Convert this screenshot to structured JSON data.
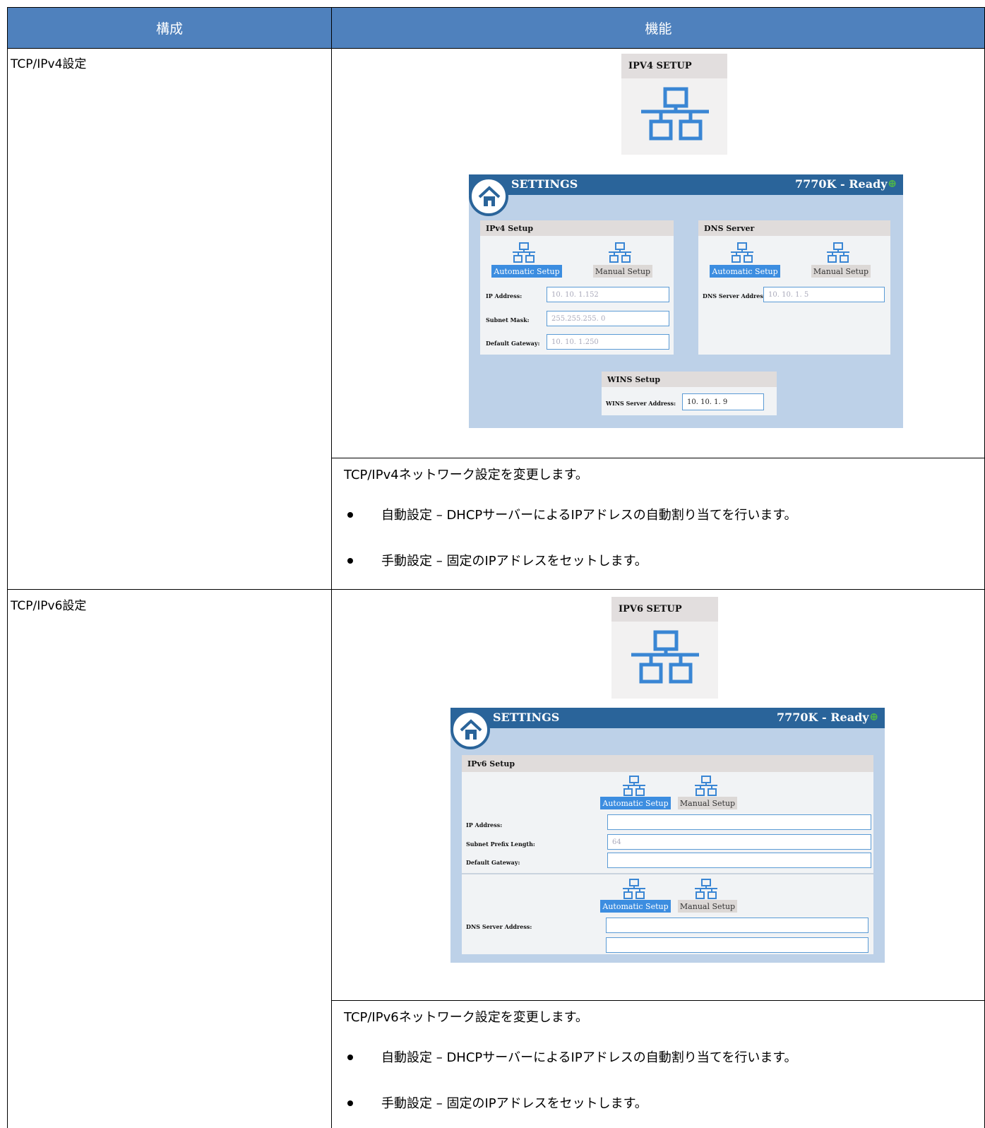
{
  "table": {
    "headers": [
      "構成",
      "機能"
    ]
  },
  "rows": [
    {
      "label": "TCP/IPv4設定",
      "tile": {
        "title": "IPV4 SETUP",
        "icon": "network-icon"
      },
      "screen": {
        "title": "SETTINGS",
        "status": "7770K - Ready",
        "ipv4_panel": {
          "title": "IPv4 Setup",
          "auto_label": "Automatic Setup",
          "manual_label": "Manual Setup",
          "fields": [
            {
              "label": "IP Address:",
              "value": "10. 10.  1.152"
            },
            {
              "label": "Subnet Mask:",
              "value": "255.255.255.  0"
            },
            {
              "label": "Default Gateway:",
              "value": "10. 10.  1.250"
            }
          ]
        },
        "dns_panel": {
          "title": "DNS Server",
          "auto_label": "Automatic Setup",
          "manual_label": "Manual Setup",
          "field_label": "DNS Server Address",
          "field_value": "10. 10.  1.  5"
        },
        "wins_panel": {
          "title": "WINS Setup",
          "field_label": "WINS Server Address:",
          "field_value": "10. 10.  1.  9"
        }
      },
      "description": "TCP/IPv4ネットワーク設定を変更します。",
      "bullets": [
        "自動設定 – DHCPサーバーによるIPアドレスの自動割り当てを行います。",
        "手動設定 – 固定のIPアドレスをセットします。"
      ]
    },
    {
      "label": "TCP/IPv6設定",
      "tile": {
        "title": "IPV6 SETUP",
        "icon": "network-icon"
      },
      "screen": {
        "title": "SETTINGS",
        "status": "7770K - Ready",
        "ipv6_panel": {
          "title": "IPv6 Setup",
          "auto_label": "Automatic Setup",
          "manual_label": "Manual Setup",
          "fields": [
            {
              "label": "IP Address:",
              "value": ""
            },
            {
              "label": "Subnet Prefix Length:",
              "value": "64"
            },
            {
              "label": "Default Gateway:",
              "value": ""
            }
          ],
          "dns_auto_label": "Automatic Setup",
          "dns_manual_label": "Manual Setup",
          "dns_label": "DNS Server Address:"
        }
      },
      "description": "TCP/IPv6ネットワーク設定を変更します。",
      "bullets": [
        "自動設定 – DHCPサーバーによるIPアドレスの自動割り当てを行います。",
        "手動設定 – 固定のIPアドレスをセットします。"
      ]
    }
  ],
  "colors": {
    "header_bg": "#4f81bd",
    "screen_bar": "#2a649a",
    "screen_bg": "#bdd1e8",
    "accent_button": "#3c8de0"
  }
}
